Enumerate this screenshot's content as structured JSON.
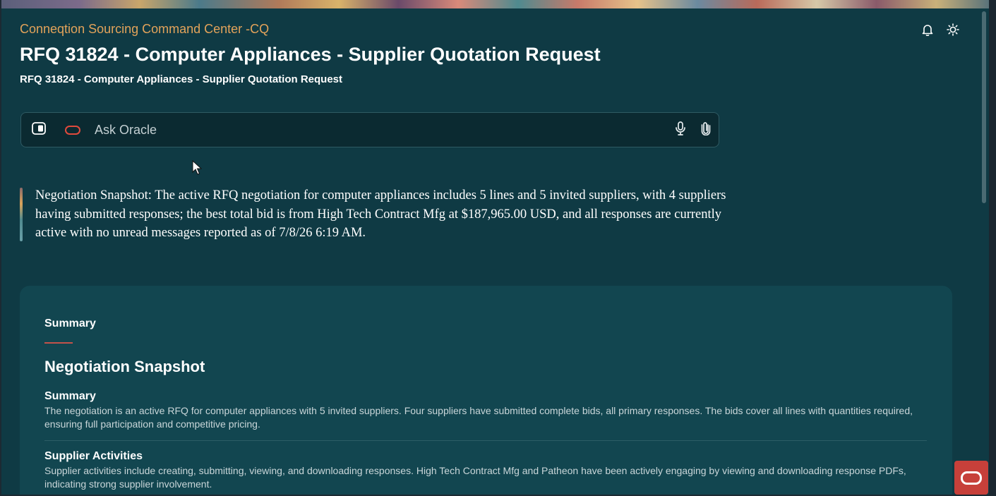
{
  "header": {
    "app_name": "Conneqtion Sourcing Command Center -CQ",
    "title": "RFQ 31824 - Computer Appliances - Supplier Quotation Request",
    "subtitle": "RFQ 31824 - Computer Appliances - Supplier Quotation Request",
    "icons": [
      "bell-icon",
      "sun-icon"
    ]
  },
  "ask_bar": {
    "placeholder": "Ask Oracle",
    "value": "",
    "icons": [
      "panel-toggle-icon",
      "oracle-logo-icon",
      "microphone-icon",
      "paperclip-icon"
    ]
  },
  "snapshot": {
    "text": "Negotiation Snapshot: The active RFQ negotiation for computer appliances includes 5 lines and 5 invited suppliers, with 4 suppliers having submitted responses; the best total bid is from High Tech Contract Mfg at $187,965.00 USD, and all responses are currently active with no unread messages reported as of 7/8/26 6:19 AM."
  },
  "card": {
    "tab_label": "Summary",
    "heading": "Negotiation Snapshot",
    "sections": [
      {
        "title": "Summary",
        "body": "The negotiation is an active RFQ for computer appliances with 5 invited suppliers. Four suppliers have submitted complete bids, all primary responses. The bids cover all lines with quantities required, ensuring full participation and competitive pricing."
      },
      {
        "title": "Supplier Activities",
        "body": "Supplier activities include creating, submitting, viewing, and downloading responses. High Tech Contract Mfg and Patheon have been actively engaging by viewing and downloading response PDFs, indicating strong supplier involvement."
      }
    ]
  },
  "colors": {
    "background": "#0f3a44",
    "card": "#124650",
    "accent_orange": "#e3a35a",
    "oracle_red": "#c7403a"
  }
}
